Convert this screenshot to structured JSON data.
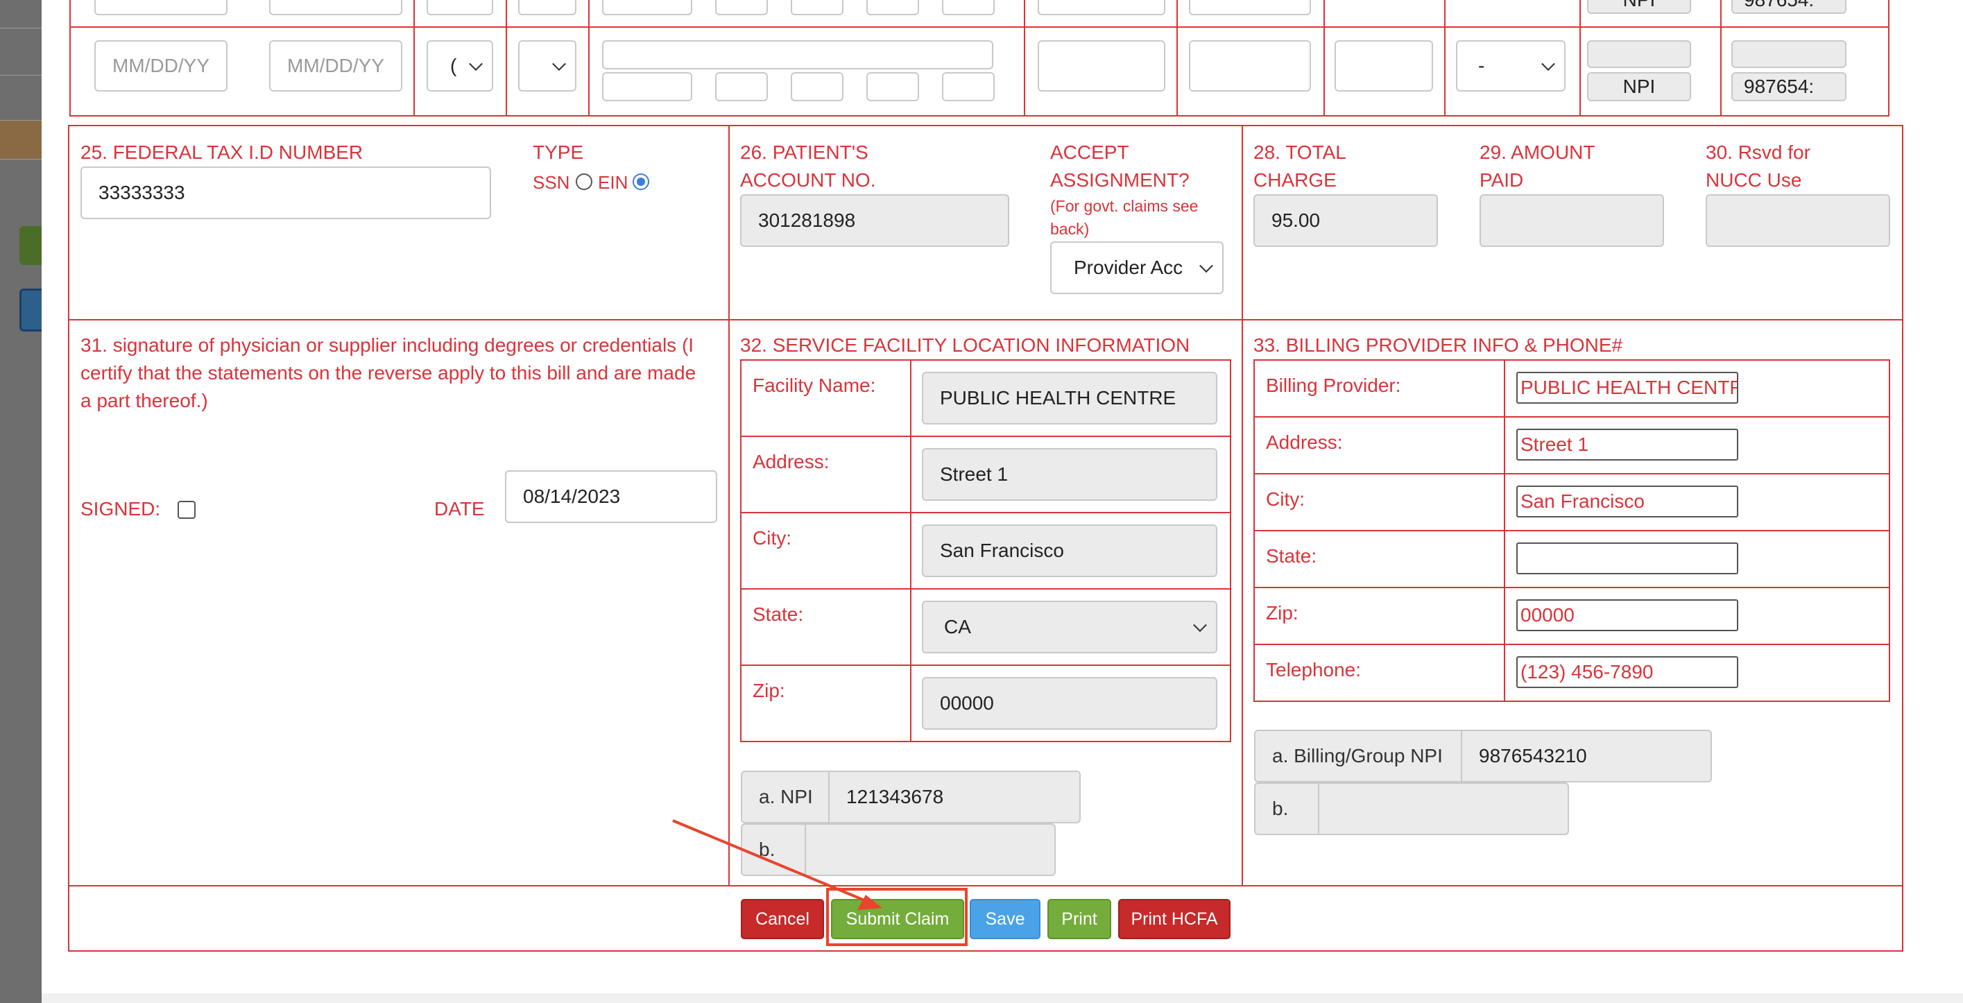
{
  "top_row": {
    "from_date_placeholder": "MM/DD/YY",
    "to_date_placeholder": "MM/DD/YY",
    "pos_value": "(",
    "emg_value": "",
    "modifier_value": "-",
    "npi_label_top": "NPI",
    "npi_label": "NPI",
    "rendering_id_top": "987654:",
    "rendering_id": "987654:"
  },
  "box25": {
    "label": "25. FEDERAL TAX I.D NUMBER",
    "value": "33333333",
    "type_label": "TYPE",
    "ssn_label": "SSN",
    "ein_label": "EIN",
    "selected": "EIN"
  },
  "box26": {
    "label_line1": "26. PATIENT'S",
    "label_line2": "ACCOUNT NO.",
    "value": "301281898"
  },
  "box27": {
    "label_line1": "ACCEPT",
    "label_line2": "ASSIGNMENT?",
    "note_line1": "(For govt. claims see",
    "note_line2": "back)",
    "value": "Provider Acc"
  },
  "box28": {
    "label_line1": "28. TOTAL",
    "label_line2": "CHARGE",
    "value": "95.00"
  },
  "box29": {
    "label_line1": "29. AMOUNT",
    "label_line2": "PAID",
    "value": ""
  },
  "box30": {
    "label_line1": "30. Rsvd for",
    "label_line2": "NUCC Use",
    "value": ""
  },
  "box31": {
    "line1": "31. signature of physician or supplier including degrees or credentials (I",
    "line2": "certify that the statements on the reverse apply to this bill and are made",
    "line3": "a part thereof.)",
    "signed_label": "SIGNED:",
    "date_label": "DATE",
    "date_value": "08/14/2023"
  },
  "box32": {
    "label": "32. SERVICE FACILITY LOCATION INFORMATION",
    "facility_label": "Facility Name:",
    "facility_value": "PUBLIC HEALTH CENTRE",
    "address_label": "Address:",
    "address_value": "Street 1",
    "city_label": "City:",
    "city_value": "San Francisco",
    "state_label": "State:",
    "state_value": "CA",
    "zip_label": "Zip:",
    "zip_value": "00000",
    "npi_a_label": "a. NPI",
    "npi_a_value": "121343678",
    "npi_b_label": "b.",
    "npi_b_value": ""
  },
  "box33": {
    "label": "33. BILLING PROVIDER INFO & PHONE#",
    "provider_label": "Billing Provider:",
    "provider_value": "PUBLIC HEALTH CENTR",
    "address_label": "Address:",
    "address_value": "Street 1",
    "city_label": "City:",
    "city_value": "San Francisco",
    "state_label": "State:",
    "state_value": "",
    "zip_label": "Zip:",
    "zip_value": "00000",
    "phone_label": "Telephone:",
    "phone_value": "(123) 456-7890",
    "group_npi_label": "a. Billing/Group NPI",
    "group_npi_value": "9876543210",
    "b_label": "b.",
    "b_value": ""
  },
  "actions": {
    "cancel": "Cancel",
    "submit": "Submit Claim",
    "save": "Save",
    "print": "Print",
    "print_hcfa": "Print HCFA"
  },
  "colors": {
    "form_red": "#d9343a",
    "cancel_red": "#c62a2a",
    "submit_green": "#74ad3b",
    "save_blue": "#4aa3e6",
    "annotation_red": "#e8452c"
  }
}
